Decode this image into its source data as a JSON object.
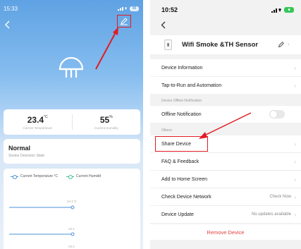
{
  "left_phone": {
    "status_bar": {
      "time": "15:33",
      "signal": "⧈▴",
      "battery": "90"
    },
    "temperature": {
      "value": "23.4",
      "unit": "°C",
      "label": "Current Temperature"
    },
    "humidity": {
      "value": "55",
      "unit": "%",
      "label": "Current Humidity"
    },
    "status": {
      "title": "Normal",
      "subtitle": "Smoke Detection State"
    },
    "chart": {
      "legend": [
        "Current Temperature °C",
        "Current Humidit"
      ],
      "point_labels": [
        "24.1°C",
        "23.1",
        "23.4"
      ]
    },
    "highlight_color": "#e11b22"
  },
  "right_phone": {
    "status_bar": {
      "time": "10:52"
    },
    "device_name": "Wifi Smoke &TH Sensor",
    "rows": {
      "device_information": "Device Information",
      "tap_to_run": "Tap-to-Run and Automation",
      "offline_section": "Device Offline Notification",
      "offline_notification": "Offline Notification",
      "others_section": "Others",
      "share_device": "Share Device",
      "faq": "FAQ & Feedback",
      "add_home": "Add to Home Screen",
      "check_network": "Check Device Network",
      "check_network_value": "Check Now",
      "device_update": "Device Update",
      "device_update_value": "No updates available"
    },
    "remove_label": "Remove Device",
    "toggle_on": false,
    "remove_color": "#e4403f"
  }
}
